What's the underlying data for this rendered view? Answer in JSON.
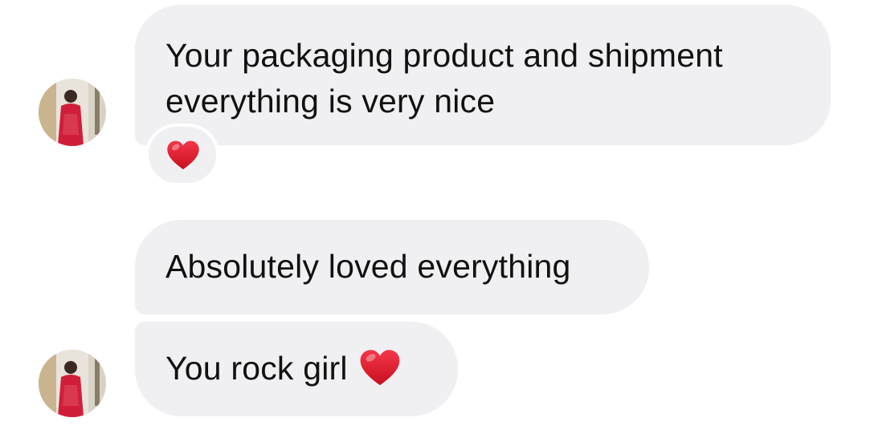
{
  "messages": [
    {
      "lines": [
        "Your packaging product and shipment",
        "everything is very nice"
      ],
      "reaction": "heart-emoji"
    },
    {
      "text": "Absolutely loved everything"
    },
    {
      "text": "You rock girl",
      "trailing_emoji": "heart-emoji"
    }
  ],
  "colors": {
    "bubble_background": "#f0f0f2",
    "text": "#111111",
    "heart": "#e0192d"
  }
}
